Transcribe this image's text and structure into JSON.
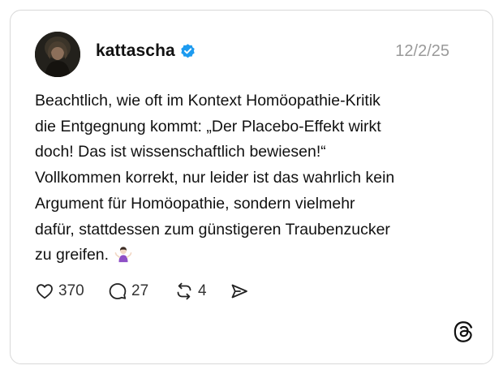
{
  "post": {
    "username": "kattascha",
    "verified": true,
    "date": "12/2/25",
    "text_lines": [
      "Beachtlich, wie oft im Kontext Homöopathie-Kritik",
      "die Entgegnung kommt: „Der Placebo-Effekt wirkt",
      "doch! Das ist wissenschaftlich bewiesen!“",
      "Vollkommen korrekt, nur leider ist das wahrlich kein",
      "Argument für Homöopathie, sondern vielmehr",
      "dafür, stattdessen zum günstigeren Traubenzucker",
      "zu greifen."
    ],
    "emoji": "person-shrugging-emoji"
  },
  "actions": {
    "likes": "370",
    "replies": "27",
    "reposts": "4",
    "icons": {
      "like": "heart-icon",
      "reply": "speech-bubble-icon",
      "repost": "repost-icon",
      "share": "send-icon"
    }
  },
  "brand": {
    "logo": "threads-logo-icon",
    "verified_color": "#1d9bf0"
  }
}
